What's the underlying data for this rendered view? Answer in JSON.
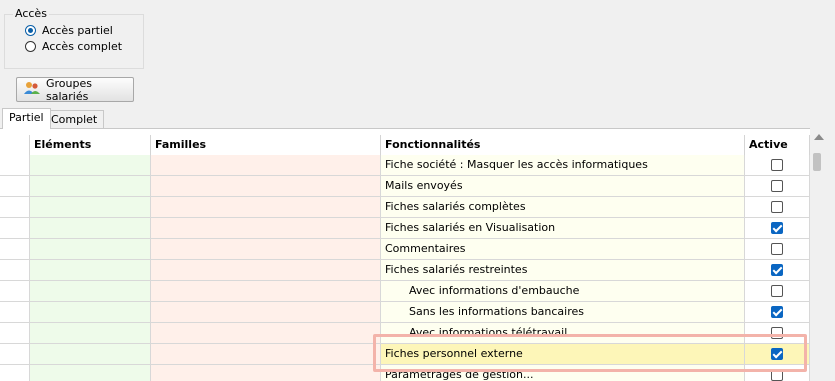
{
  "access_group": {
    "title": "Accès",
    "options": [
      {
        "label": "Accès partiel",
        "selected": true
      },
      {
        "label": "Accès complet",
        "selected": false
      }
    ]
  },
  "groups_button": {
    "label": "Groupes salariés",
    "icon": "users-icon"
  },
  "tabs": [
    {
      "label": "Partiel",
      "active": true
    },
    {
      "label": "Complet",
      "active": false
    }
  ],
  "grid": {
    "columns": [
      "Eléments",
      "Familles",
      "Fonctionnalités",
      "Active"
    ],
    "rows": [
      {
        "feature": "Fiche société : Masquer les accès informatiques",
        "active": false
      },
      {
        "feature": "Mails envoyés",
        "active": false
      },
      {
        "feature": "Fiches salariés complètes",
        "active": false
      },
      {
        "feature": "Fiches salariés en Visualisation",
        "active": true
      },
      {
        "feature": "Commentaires",
        "active": false
      },
      {
        "feature": "Fiches salariés restreintes",
        "active": true
      },
      {
        "feature": "Avec informations d'embauche",
        "active": false,
        "indent": true
      },
      {
        "feature": "Sans les informations bancaires",
        "active": true,
        "indent": true
      },
      {
        "feature": "Avec informations télétravail",
        "active": false,
        "indent": true
      },
      {
        "feature": "Fiches personnel externe",
        "active": true,
        "highlighted": true
      },
      {
        "feature": "Paramétrages de gestion...",
        "active": false
      }
    ]
  },
  "colors": {
    "accent": "#0a66c2",
    "highlight_border": "#f3b3aa",
    "highlight_fill": "#fdf6b8"
  }
}
